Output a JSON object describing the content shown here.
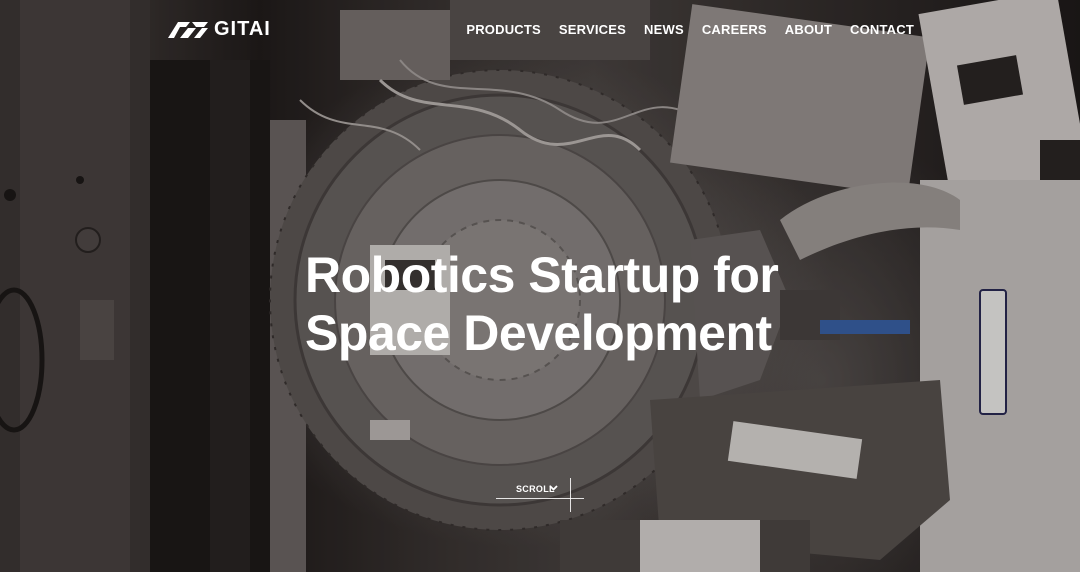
{
  "brand": {
    "name": "GITAI",
    "logo_icon": "gitai-logo-mark-icon"
  },
  "nav": {
    "items": [
      {
        "label": "PRODUCTS"
      },
      {
        "label": "SERVICES"
      },
      {
        "label": "NEWS"
      },
      {
        "label": "CAREERS"
      },
      {
        "label": "ABOUT"
      },
      {
        "label": "CONTACT"
      }
    ]
  },
  "hero": {
    "headline_line1": "Robotics Startup for",
    "headline_line2": "Space Development",
    "scroll_label": "SCROLL",
    "scroll_icon": "chevron-down-icon"
  },
  "colors": {
    "text": "#ffffff",
    "background": "#2c2726"
  }
}
